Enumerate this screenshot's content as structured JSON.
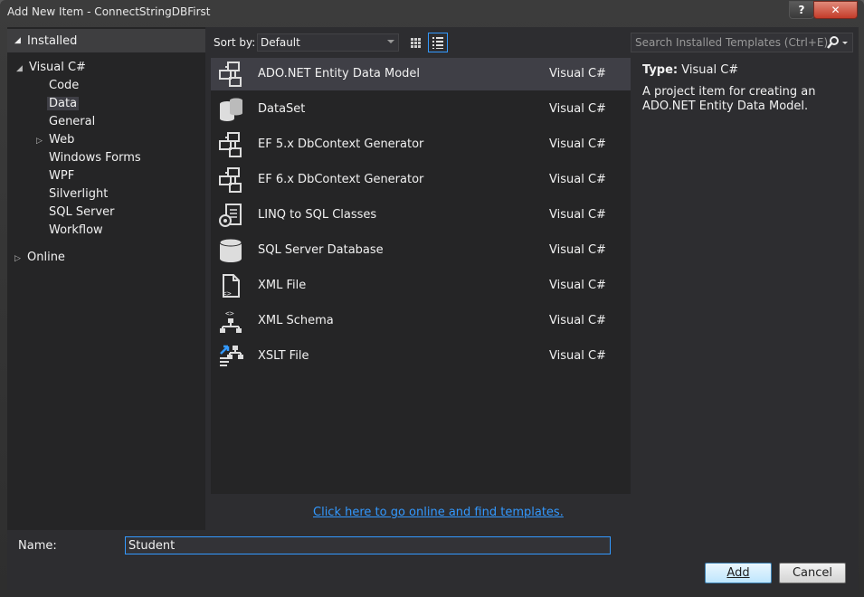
{
  "window": {
    "title": "Add New Item - ConnectStringDBFirst",
    "help_label": "?",
    "close_label": "✕"
  },
  "tree": {
    "installed_label": "Installed",
    "nodes": [
      "Visual C#",
      "Code",
      "Data",
      "General",
      "Web",
      "Windows Forms",
      "WPF",
      "Silverlight",
      "SQL Server",
      "Workflow",
      "Online"
    ],
    "selected": "Data"
  },
  "toolbar": {
    "sort_label": "Sort by:",
    "sort_value": "Default",
    "search_placeholder": "Search Installed Templates (Ctrl+E)"
  },
  "templates": [
    {
      "name": "ADO.NET Entity Data Model",
      "lang": "Visual C#",
      "icon": "entity-model-icon"
    },
    {
      "name": "DataSet",
      "lang": "Visual C#",
      "icon": "dataset-icon"
    },
    {
      "name": "EF 5.x DbContext Generator",
      "lang": "Visual C#",
      "icon": "entity-model-icon"
    },
    {
      "name": "EF 6.x DbContext Generator",
      "lang": "Visual C#",
      "icon": "entity-model-icon"
    },
    {
      "name": "LINQ to SQL Classes",
      "lang": "Visual C#",
      "icon": "linq-classes-icon"
    },
    {
      "name": "SQL Server Database",
      "lang": "Visual C#",
      "icon": "database-icon"
    },
    {
      "name": "XML File",
      "lang": "Visual C#",
      "icon": "xml-file-icon"
    },
    {
      "name": "XML Schema",
      "lang": "Visual C#",
      "icon": "xml-schema-icon"
    },
    {
      "name": "XSLT File",
      "lang": "Visual C#",
      "icon": "xslt-file-icon"
    }
  ],
  "details": {
    "type_label": "Type:",
    "type_value": "Visual C#",
    "description": "A project item for creating an ADO.NET Entity Data Model."
  },
  "online_link": "Click here to go online and find templates.",
  "bottom": {
    "name_label": "Name:",
    "name_value": "Student",
    "add_label": "Add",
    "cancel_label": "Cancel"
  },
  "colors": {
    "accent": "#3399ff",
    "background": "#2d2d30",
    "panel": "#252526",
    "selection": "#3f3f46"
  }
}
